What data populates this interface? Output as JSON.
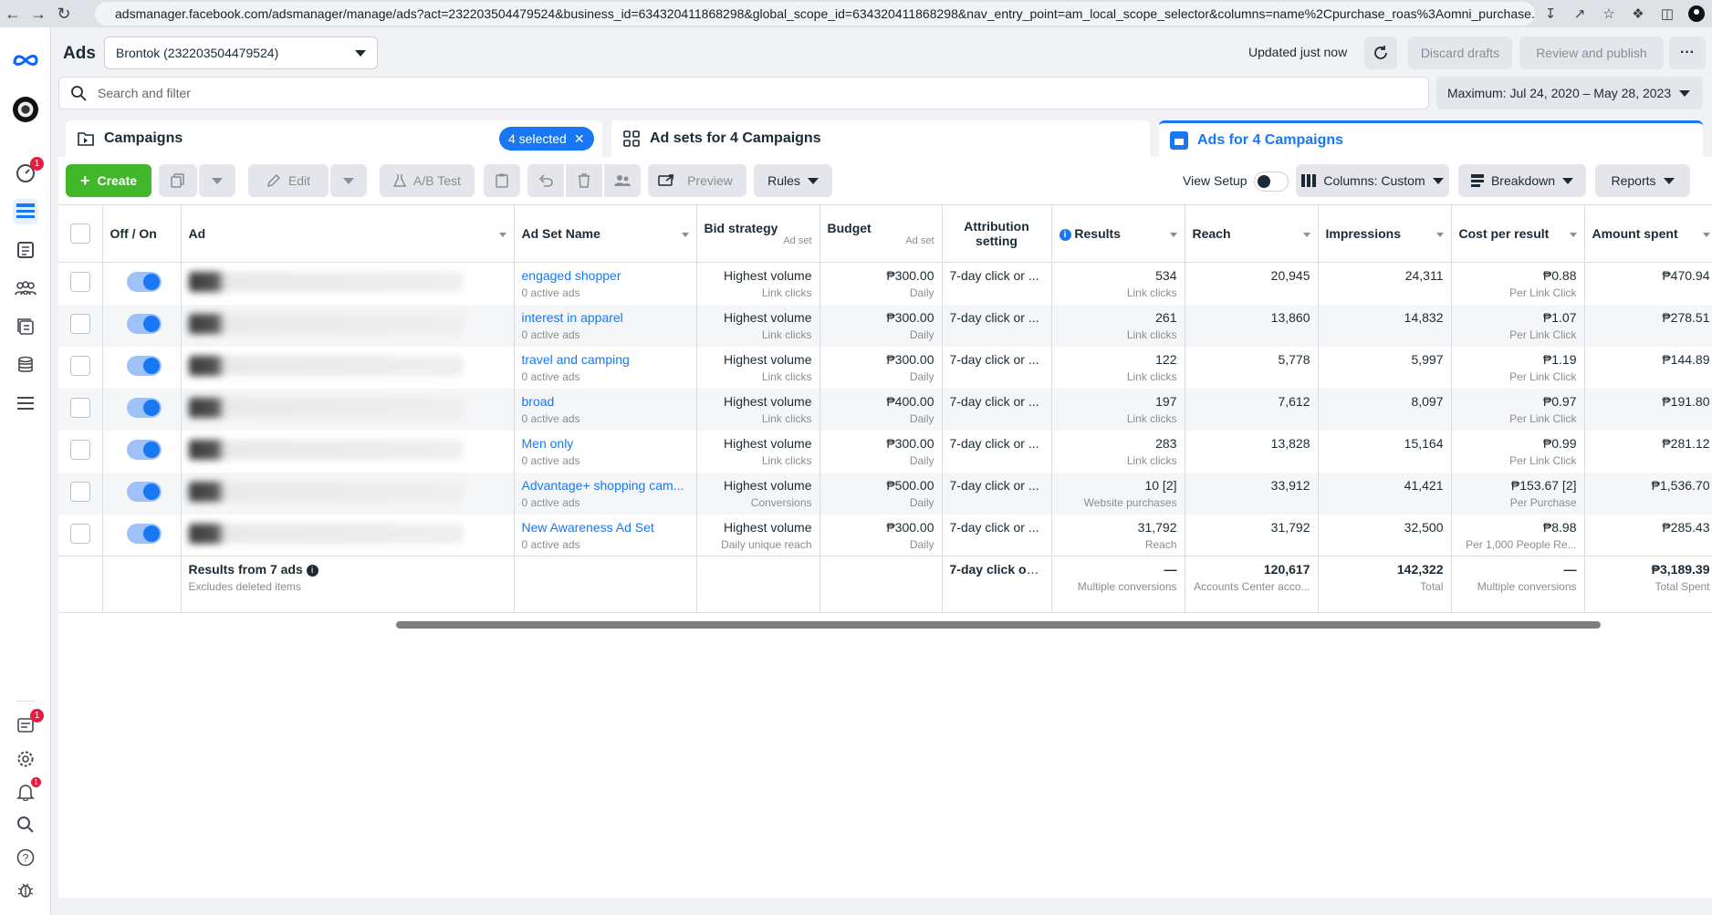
{
  "browser": {
    "url": "adsmanager.facebook.com/adsmanager/manage/ads?act=232203504479524&business_id=634320411868298&global_scope_id=634320411868298&nav_entry_point=am_local_scope_selector&columns=name%2Cpurchase_roas%3Aomni_purchase..."
  },
  "header": {
    "app_title": "Ads",
    "account_selector": "Brontok (232203504479524)",
    "updated_text": "Updated just now",
    "discard_label": "Discard drafts",
    "review_label": "Review and publish",
    "more_label": "···"
  },
  "search": {
    "placeholder": "Search and filter",
    "date_range": "Maximum: Jul 24, 2020 – May 28, 2023"
  },
  "level_tabs": {
    "campaigns": "Campaigns",
    "selected_chip": "4 selected",
    "adsets": "Ad sets for 4 Campaigns",
    "ads": "Ads for 4 Campaigns"
  },
  "left_rail": {
    "badges": {
      "activity": "1",
      "notifications_box": "1",
      "alerts": "1"
    }
  },
  "toolbar": {
    "create": "Create",
    "edit": "Edit",
    "ab_test": "A/B Test",
    "preview": "Preview",
    "rules": "Rules",
    "view_setup": "View Setup",
    "columns": "Columns: Custom",
    "breakdown": "Breakdown",
    "reports": "Reports"
  },
  "table": {
    "headers": {
      "off_on": "Off / On",
      "ad": "Ad",
      "ad_set_name": "Ad Set Name",
      "bid_strategy": "Bid strategy",
      "bid_strategy_sub": "Ad set",
      "budget": "Budget",
      "budget_sub": "Ad set",
      "attribution_1": "Attribution",
      "attribution_2": "setting",
      "results": "Results",
      "reach": "Reach",
      "impressions": "Impressions",
      "cost_per_result": "Cost per result",
      "amount_spent": "Amount spent"
    },
    "rows": [
      {
        "ad_set": "engaged shopper",
        "ad_set_sub": "0 active ads",
        "bid": "Highest volume",
        "bid_sub": "Link clicks",
        "budget": "₱300.00",
        "budget_sub": "Daily",
        "attribution": "7-day click or ...",
        "results": "534",
        "results_sub": "Link clicks",
        "reach": "20,945",
        "impressions": "24,311",
        "cpr": "₱0.88",
        "cpr_sub": "Per Link Click",
        "spent": "₱470.94"
      },
      {
        "ad_set": "interest in apparel",
        "ad_set_sub": "0 active ads",
        "bid": "Highest volume",
        "bid_sub": "Link clicks",
        "budget": "₱300.00",
        "budget_sub": "Daily",
        "attribution": "7-day click or ...",
        "results": "261",
        "results_sub": "Link clicks",
        "reach": "13,860",
        "impressions": "14,832",
        "cpr": "₱1.07",
        "cpr_sub": "Per Link Click",
        "spent": "₱278.51"
      },
      {
        "ad_set": "travel and camping",
        "ad_set_sub": "0 active ads",
        "bid": "Highest volume",
        "bid_sub": "Link clicks",
        "budget": "₱300.00",
        "budget_sub": "Daily",
        "attribution": "7-day click or ...",
        "results": "122",
        "results_sub": "Link clicks",
        "reach": "5,778",
        "impressions": "5,997",
        "cpr": "₱1.19",
        "cpr_sub": "Per Link Click",
        "spent": "₱144.89"
      },
      {
        "ad_set": "broad",
        "ad_set_sub": "0 active ads",
        "bid": "Highest volume",
        "bid_sub": "Link clicks",
        "budget": "₱400.00",
        "budget_sub": "Daily",
        "attribution": "7-day click or ...",
        "results": "197",
        "results_sub": "Link clicks",
        "reach": "7,612",
        "impressions": "8,097",
        "cpr": "₱0.97",
        "cpr_sub": "Per Link Click",
        "spent": "₱191.80"
      },
      {
        "ad_set": "Men only",
        "ad_set_sub": "0 active ads",
        "bid": "Highest volume",
        "bid_sub": "Link clicks",
        "budget": "₱300.00",
        "budget_sub": "Daily",
        "attribution": "7-day click or ...",
        "results": "283",
        "results_sub": "Link clicks",
        "reach": "13,828",
        "impressions": "15,164",
        "cpr": "₱0.99",
        "cpr_sub": "Per Link Click",
        "spent": "₱281.12"
      },
      {
        "ad_set": "Advantage+ shopping cam...",
        "ad_set_sub": "0 active ads",
        "bid": "Highest volume",
        "bid_sub": "Conversions",
        "budget": "₱500.00",
        "budget_sub": "Daily",
        "attribution": "7-day click or ...",
        "results": "10 [2]",
        "results_sub": "Website purchases",
        "reach": "33,912",
        "impressions": "41,421",
        "cpr": "₱153.67 [2]",
        "cpr_sub": "Per Purchase",
        "spent": "₱1,536.70"
      },
      {
        "ad_set": "New Awareness Ad Set",
        "ad_set_sub": "0 active ads",
        "bid": "Highest volume",
        "bid_sub": "Daily unique reach",
        "budget": "₱300.00",
        "budget_sub": "Daily",
        "attribution": "7-day click or ...",
        "results": "31,792",
        "results_sub": "Reach",
        "reach": "31,792",
        "impressions": "32,500",
        "cpr": "₱8.98",
        "cpr_sub": "Per 1,000 People Re...",
        "spent": "₱285.43"
      }
    ],
    "summary": {
      "title": "Results from 7 ads",
      "subtitle": "Excludes deleted items",
      "attribution": "7-day click or ...",
      "results": "—",
      "results_sub": "Multiple conversions",
      "reach": "120,617",
      "reach_sub": "Accounts Center acco...",
      "impressions": "142,322",
      "impressions_sub": "Total",
      "cpr": "—",
      "cpr_sub": "Multiple conversions",
      "spent": "₱3,189.39",
      "spent_sub": "Total Spent"
    }
  },
  "colors": {
    "accent": "#1877f2",
    "create_green": "#42b72a",
    "badge_red": "#e41e3f"
  }
}
